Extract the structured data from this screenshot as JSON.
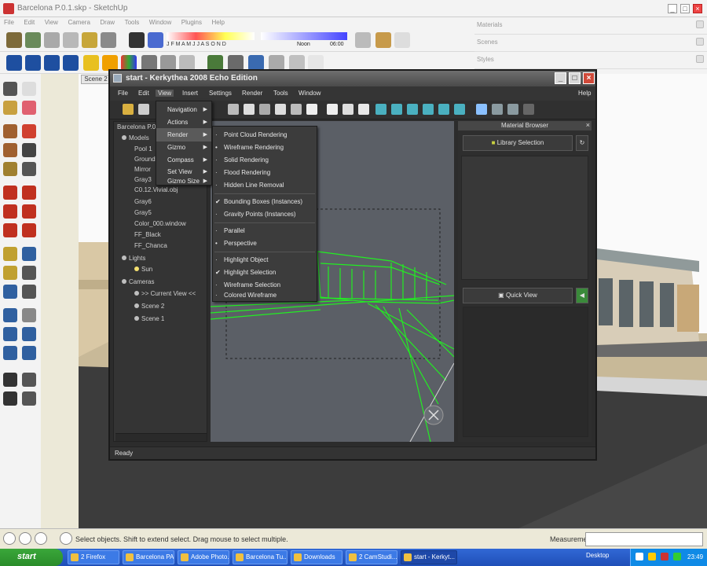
{
  "sketchup": {
    "title": "Barcelona P.0.1.skp - SketchUp",
    "menus": [
      "File",
      "Edit",
      "View",
      "Camera",
      "Draw",
      "Tools",
      "Window",
      "Plugins",
      "Help"
    ],
    "toolbar_colors": [
      "J F M A M J J A S O N D",
      "Noon",
      "06:00"
    ],
    "scene_tab": "Scene 2",
    "panels": [
      "Materials",
      "Scenes",
      "Styles"
    ],
    "status_text": "Select objects. Shift to extend select. Drag mouse to select multiple.",
    "measurements_label": "Measurements"
  },
  "kerkythea": {
    "title": "start - Kerkythea 2008 Echo Edition",
    "menus": [
      "File",
      "Edit",
      "View",
      "Insert",
      "Settings",
      "Render",
      "Tools",
      "Window",
      "Help"
    ],
    "tree": {
      "root": "Barcelona P.0...",
      "models_label": "Models",
      "models": [
        "Pool 1",
        "Ground",
        "Mirror",
        "Gray3",
        "C0.12.Vivial.obj",
        "Gray6",
        "Gray5",
        "Color_000.window",
        "FF_Black",
        "FF_Chanca"
      ],
      "lights_label": "Lights",
      "lights": [
        "Sun"
      ],
      "cameras_label": "Cameras",
      "cameras": [
        ">> Current View <<",
        "Scene 2",
        "Scene 1"
      ]
    },
    "view_menu": [
      "Navigation",
      "Actions",
      "Render",
      "Gizmo",
      "Compass",
      "Set View",
      "Gizmo Size"
    ],
    "render_submenu": {
      "group1": [
        "Point Cloud Rendering",
        "Wireframe Rendering",
        "Solid Rendering",
        "Flood Rendering",
        "Hidden Line Removal"
      ],
      "group2": [
        "Bounding Boxes (Instances)",
        "Gravity Points (Instances)"
      ],
      "group3": [
        "Parallel",
        "Perspective"
      ],
      "group4": [
        "Highlight Object",
        "Highlight Selection",
        "Wireframe Selection",
        "Colored Wireframe"
      ]
    },
    "material_browser": {
      "title": "Material Browser",
      "library_button": "Library Selection",
      "quick_view_button": "Quick View"
    },
    "status": "Ready"
  },
  "taskbar": {
    "start": "start",
    "tasks": [
      "2 Firefox",
      "Barcelona PA...",
      "Adobe Photo...",
      "Barcelona Tu...",
      "Downloads",
      "2 CamStudi...",
      "start - Kerkyt..."
    ],
    "tray_text": "Desktop",
    "clock": "23:49"
  }
}
